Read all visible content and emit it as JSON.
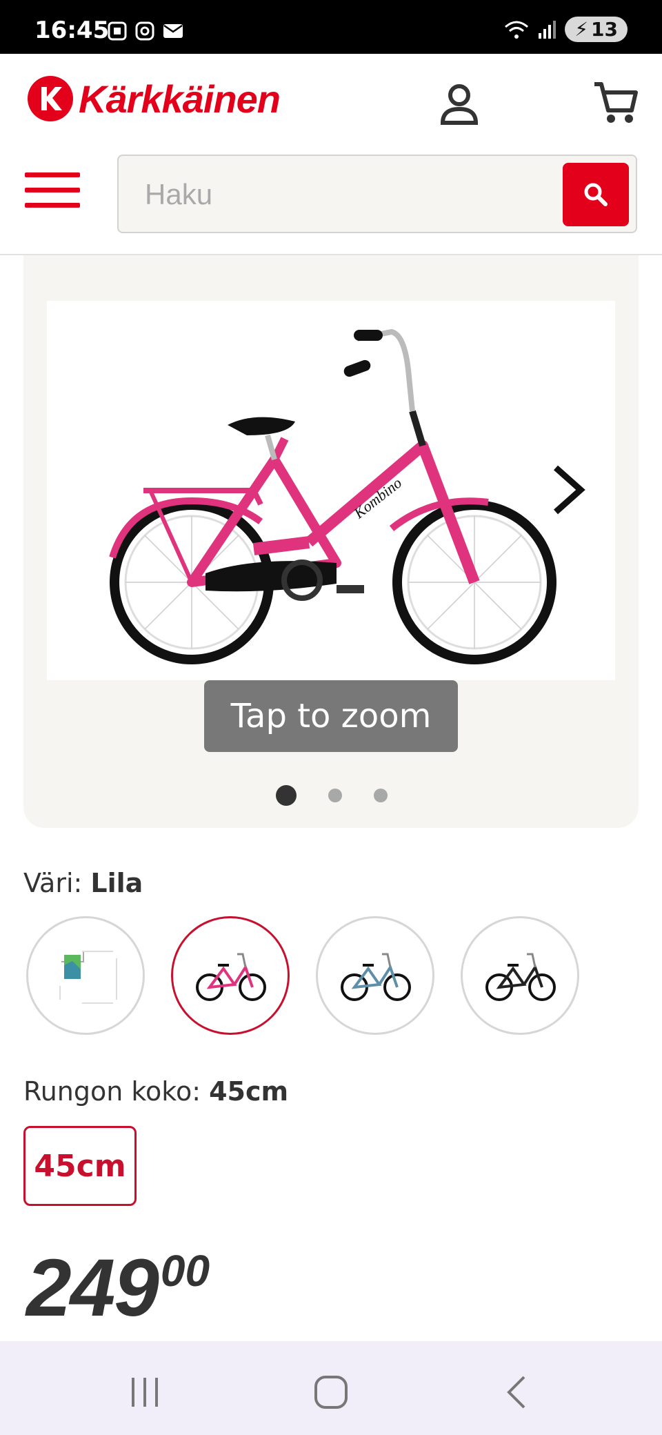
{
  "status_bar": {
    "time": "16:45",
    "battery": "13"
  },
  "brand": {
    "name": "Kärkkäinen",
    "accent": "#e3001b"
  },
  "search": {
    "placeholder": "Haku"
  },
  "gallery": {
    "zoom_label": "Tap to zoom",
    "total_images": 3,
    "active_index": 0,
    "product_text": "Kombino"
  },
  "color": {
    "label": "Väri:",
    "value": "Lila",
    "options": [
      "broken-image",
      "pink",
      "blue",
      "black"
    ],
    "selected": 1
  },
  "size": {
    "label": "Rungon koko:",
    "value": "45cm",
    "options": [
      "45cm"
    ]
  },
  "price": {
    "integer": "249",
    "decimals": "00"
  },
  "icons": [
    "user-icon",
    "cart-icon",
    "menu-icon",
    "search-icon",
    "chevron-right-icon",
    "recents-icon",
    "home-icon",
    "back-icon"
  ]
}
